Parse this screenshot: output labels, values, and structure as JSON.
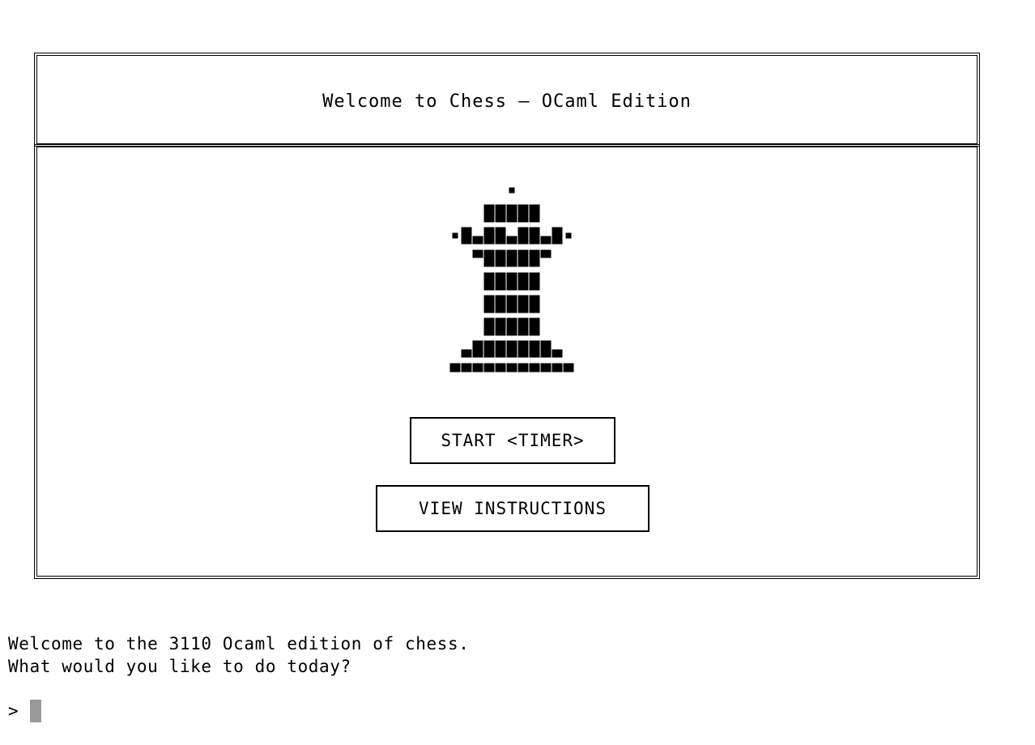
{
  "header": {
    "title": "Welcome to Chess – OCaml Edition"
  },
  "menu": {
    "start_label": "START <TIMER>",
    "instructions_label": "VIEW INSTRUCTIONS"
  },
  "console": {
    "line1": "Welcome to the 3110 Ocaml edition of chess.",
    "line2": "What would you like to do today?",
    "prompt": ">"
  },
  "icons": {
    "piece": "chess-queen-pixel-art"
  },
  "colors": {
    "foreground": "#000000",
    "background": "#ffffff",
    "cursor": "#999999"
  }
}
